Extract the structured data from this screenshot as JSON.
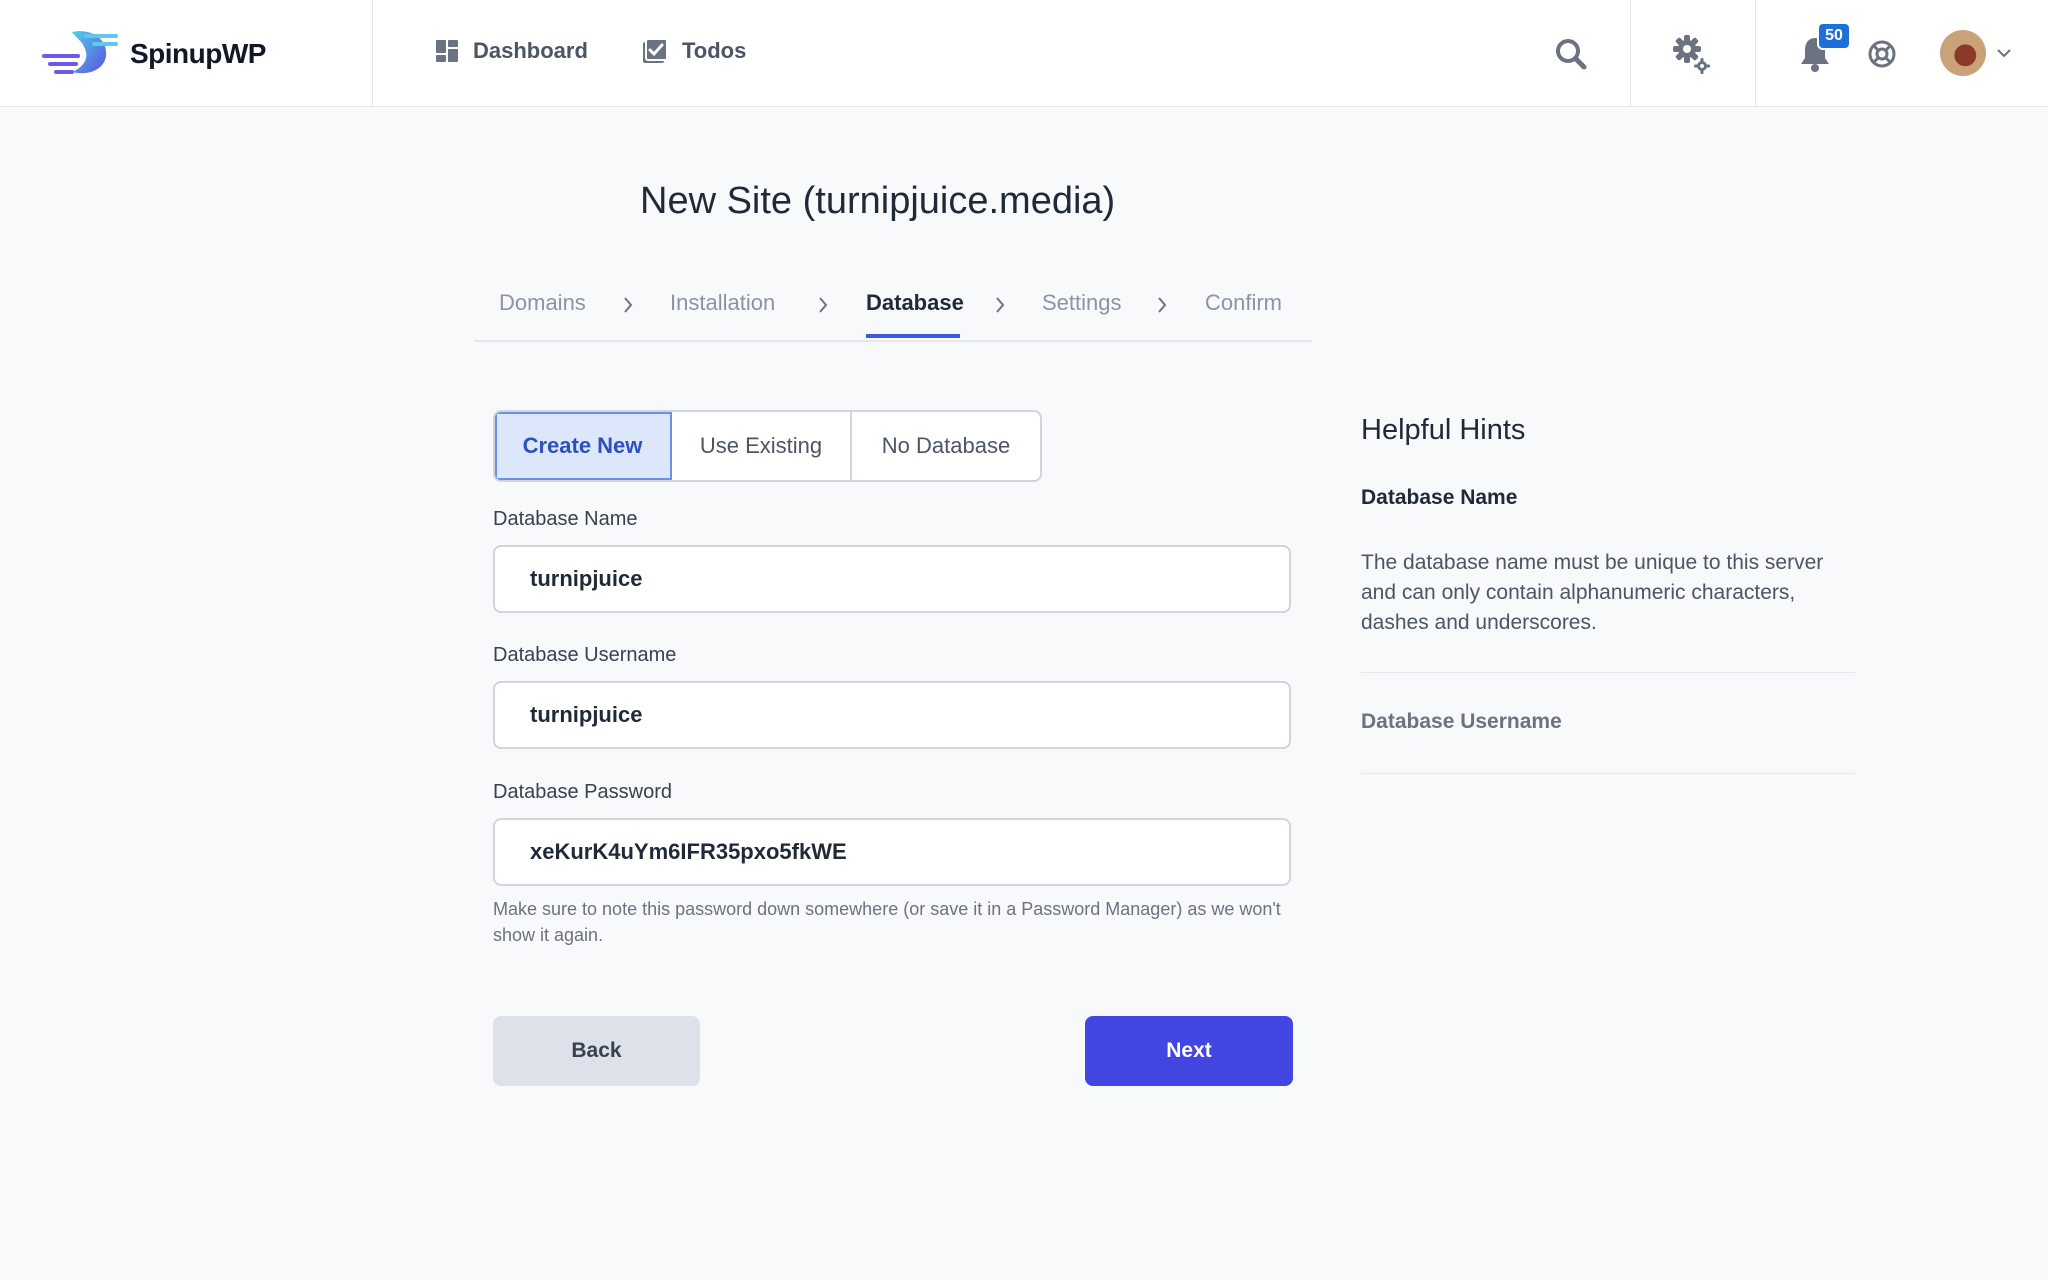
{
  "brand": {
    "name": "SpinupWP"
  },
  "nav": {
    "items": [
      {
        "label": "Dashboard",
        "icon": "dashboard-icon"
      },
      {
        "label": "Todos",
        "icon": "todos-icon"
      }
    ]
  },
  "header": {
    "notification_count": "50",
    "icons": [
      "search-icon",
      "gear-icon",
      "bell-icon",
      "help-icon",
      "avatar",
      "chevron-down-icon"
    ]
  },
  "page": {
    "title": "New Site (turnipjuice.media)",
    "steps": [
      {
        "label": "Domains"
      },
      {
        "label": "Installation"
      },
      {
        "label": "Database"
      },
      {
        "label": "Settings"
      },
      {
        "label": "Confirm"
      }
    ],
    "active_step": "Database"
  },
  "db_mode": {
    "options": [
      "Create New",
      "Use Existing",
      "No Database"
    ],
    "selected": "Create New"
  },
  "form": {
    "db_name": {
      "label": "Database Name",
      "value": "turnipjuice"
    },
    "db_user": {
      "label": "Database Username",
      "value": "turnipjuice"
    },
    "db_pass": {
      "label": "Database Password",
      "value": "xeKurK4uYm6IFR35pxo5fkWE"
    },
    "password_note": "Make sure to note this password down somewhere (or save it in a Password Manager) as we won't show it again."
  },
  "actions": {
    "back": "Back",
    "next": "Next"
  },
  "hints": {
    "title": "Helpful Hints",
    "sections": [
      {
        "title": "Database Name",
        "body": "The database name must be unique to this server and can only contain alphanumeric characters, dashes and underscores."
      },
      {
        "title": "Database Username"
      }
    ]
  },
  "colors": {
    "primary": "#4245e0",
    "active_tab": "#3b5bdb",
    "badge": "#1d6fdc",
    "segment_active_bg": "#dde7fb"
  }
}
